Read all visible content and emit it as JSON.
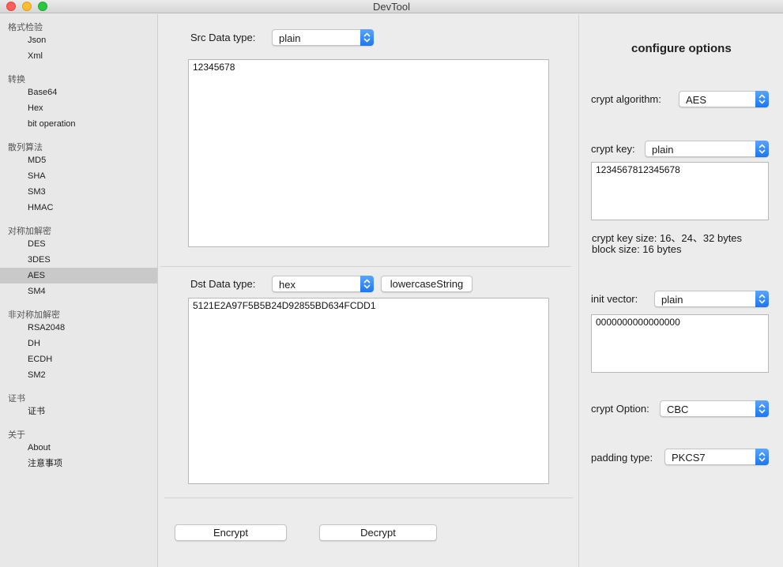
{
  "window": {
    "title": "DevTool"
  },
  "sidebar": {
    "groups": [
      {
        "title": "格式检验",
        "items": [
          "Json",
          "Xml"
        ]
      },
      {
        "title": "转换",
        "items": [
          "Base64",
          "Hex",
          "bit operation"
        ]
      },
      {
        "title": "散列算法",
        "items": [
          "MD5",
          "SHA",
          "SM3",
          "HMAC"
        ]
      },
      {
        "title": "对称加解密",
        "items": [
          "DES",
          "3DES",
          "AES",
          "SM4"
        ]
      },
      {
        "title": "非对称加解密",
        "items": [
          "RSA2048",
          "DH",
          "ECDH",
          "SM2"
        ]
      },
      {
        "title": "证书",
        "items": [
          "证书"
        ]
      },
      {
        "title": "关于",
        "items": [
          "About",
          "注意事项"
        ]
      }
    ],
    "selected": "AES"
  },
  "src": {
    "label": "Src Data type:",
    "type": "plain",
    "content": "12345678"
  },
  "dst": {
    "label": "Dst Data type:",
    "type": "hex",
    "case_button": "lowercaseString",
    "content": "5121E2A97F5B5B24D92855BD634FCDD1"
  },
  "actions": {
    "encrypt": "Encrypt",
    "decrypt": "Decrypt"
  },
  "options": {
    "heading": "configure options",
    "algorithm_label": "crypt algorithm:",
    "algorithm": "AES",
    "key_label": "crypt key:",
    "key_type": "plain",
    "key_value": "1234567812345678",
    "key_size_note": "crypt key size: 16、24、32 bytes",
    "block_size_note": "block size: 16 bytes",
    "iv_label": "init vector:",
    "iv_type": "plain",
    "iv_value": "0000000000000000",
    "option_label": "crypt Option:",
    "option": "CBC",
    "padding_label": "padding type:",
    "padding": "PKCS7"
  },
  "colors": {
    "accent": "#1b76f0",
    "selection": "#c9c9c9"
  }
}
